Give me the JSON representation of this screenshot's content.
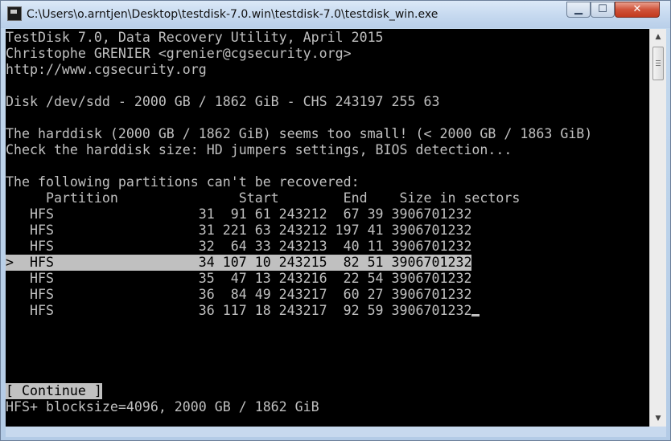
{
  "window": {
    "title": "C:\\Users\\o.arntjen\\Desktop\\testdisk-7.0.win\\testdisk-7.0\\testdisk_win.exe",
    "buttons": {
      "minimize": "▁",
      "maximize": "☐",
      "close": "✕"
    }
  },
  "console": {
    "header": [
      "TestDisk 7.0, Data Recovery Utility, April 2015",
      "Christophe GRENIER <grenier@cgsecurity.org>",
      "http://www.cgsecurity.org"
    ],
    "disk_info": "Disk /dev/sdd - 2000 GB / 1862 GiB - CHS 243197 255 63",
    "warnings": [
      "The harddisk (2000 GB / 1862 GiB) seems too small! (< 2000 GB / 1863 GiB)",
      "Check the harddisk size: HD jumpers settings, BIOS detection..."
    ],
    "partitions_title": "The following partitions can't be recovered:",
    "table_header": "     Partition               Start        End    Size in sectors",
    "selected_marker": ">",
    "rows": [
      {
        "type": "HFS",
        "start": "31  91 61",
        "end": "243212  67 39",
        "size": "3906701232"
      },
      {
        "type": "HFS",
        "start": "31 221 63",
        "end": "243212 197 41",
        "size": "3906701232"
      },
      {
        "type": "HFS",
        "start": "32  64 33",
        "end": "243213  40 11",
        "size": "3906701232"
      },
      {
        "type": "HFS",
        "start": "34 107 10",
        "end": "243215  82 51",
        "size": "3906701232"
      },
      {
        "type": "HFS",
        "start": "35  47 13",
        "end": "243216  22 54",
        "size": "3906701232"
      },
      {
        "type": "HFS",
        "start": "36  84 49",
        "end": "243217  60 27",
        "size": "3906701232"
      },
      {
        "type": "HFS",
        "start": "36 117 18",
        "end": "243217  92 59",
        "size": "3906701232"
      }
    ],
    "selected_row": 3,
    "continue_label": "[ Continue ]",
    "status": "HFS+ blocksize=4096, 2000 GB / 1862 GiB"
  }
}
